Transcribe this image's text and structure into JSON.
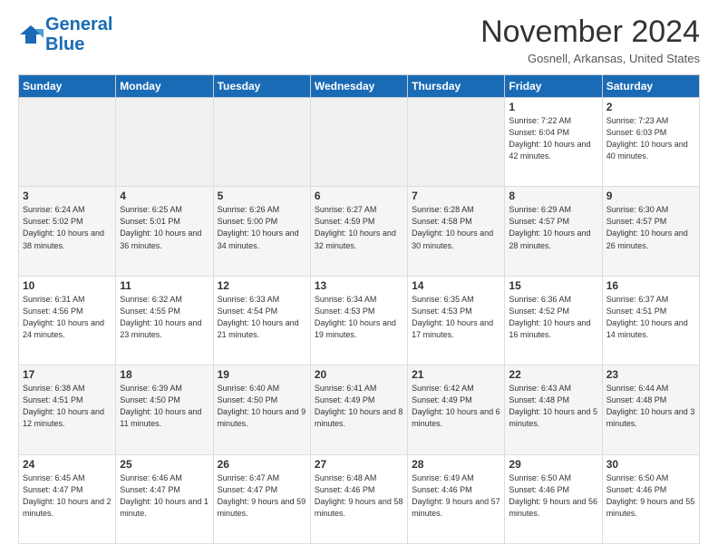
{
  "header": {
    "logo_line1": "General",
    "logo_line2": "Blue",
    "month_title": "November 2024",
    "location": "Gosnell, Arkansas, United States"
  },
  "weekdays": [
    "Sunday",
    "Monday",
    "Tuesday",
    "Wednesday",
    "Thursday",
    "Friday",
    "Saturday"
  ],
  "weeks": [
    [
      {
        "day": "",
        "info": ""
      },
      {
        "day": "",
        "info": ""
      },
      {
        "day": "",
        "info": ""
      },
      {
        "day": "",
        "info": ""
      },
      {
        "day": "",
        "info": ""
      },
      {
        "day": "1",
        "info": "Sunrise: 7:22 AM\nSunset: 6:04 PM\nDaylight: 10 hours\nand 42 minutes."
      },
      {
        "day": "2",
        "info": "Sunrise: 7:23 AM\nSunset: 6:03 PM\nDaylight: 10 hours\nand 40 minutes."
      }
    ],
    [
      {
        "day": "3",
        "info": "Sunrise: 6:24 AM\nSunset: 5:02 PM\nDaylight: 10 hours\nand 38 minutes."
      },
      {
        "day": "4",
        "info": "Sunrise: 6:25 AM\nSunset: 5:01 PM\nDaylight: 10 hours\nand 36 minutes."
      },
      {
        "day": "5",
        "info": "Sunrise: 6:26 AM\nSunset: 5:00 PM\nDaylight: 10 hours\nand 34 minutes."
      },
      {
        "day": "6",
        "info": "Sunrise: 6:27 AM\nSunset: 4:59 PM\nDaylight: 10 hours\nand 32 minutes."
      },
      {
        "day": "7",
        "info": "Sunrise: 6:28 AM\nSunset: 4:58 PM\nDaylight: 10 hours\nand 30 minutes."
      },
      {
        "day": "8",
        "info": "Sunrise: 6:29 AM\nSunset: 4:57 PM\nDaylight: 10 hours\nand 28 minutes."
      },
      {
        "day": "9",
        "info": "Sunrise: 6:30 AM\nSunset: 4:57 PM\nDaylight: 10 hours\nand 26 minutes."
      }
    ],
    [
      {
        "day": "10",
        "info": "Sunrise: 6:31 AM\nSunset: 4:56 PM\nDaylight: 10 hours\nand 24 minutes."
      },
      {
        "day": "11",
        "info": "Sunrise: 6:32 AM\nSunset: 4:55 PM\nDaylight: 10 hours\nand 23 minutes."
      },
      {
        "day": "12",
        "info": "Sunrise: 6:33 AM\nSunset: 4:54 PM\nDaylight: 10 hours\nand 21 minutes."
      },
      {
        "day": "13",
        "info": "Sunrise: 6:34 AM\nSunset: 4:53 PM\nDaylight: 10 hours\nand 19 minutes."
      },
      {
        "day": "14",
        "info": "Sunrise: 6:35 AM\nSunset: 4:53 PM\nDaylight: 10 hours\nand 17 minutes."
      },
      {
        "day": "15",
        "info": "Sunrise: 6:36 AM\nSunset: 4:52 PM\nDaylight: 10 hours\nand 16 minutes."
      },
      {
        "day": "16",
        "info": "Sunrise: 6:37 AM\nSunset: 4:51 PM\nDaylight: 10 hours\nand 14 minutes."
      }
    ],
    [
      {
        "day": "17",
        "info": "Sunrise: 6:38 AM\nSunset: 4:51 PM\nDaylight: 10 hours\nand 12 minutes."
      },
      {
        "day": "18",
        "info": "Sunrise: 6:39 AM\nSunset: 4:50 PM\nDaylight: 10 hours\nand 11 minutes."
      },
      {
        "day": "19",
        "info": "Sunrise: 6:40 AM\nSunset: 4:50 PM\nDaylight: 10 hours\nand 9 minutes."
      },
      {
        "day": "20",
        "info": "Sunrise: 6:41 AM\nSunset: 4:49 PM\nDaylight: 10 hours\nand 8 minutes."
      },
      {
        "day": "21",
        "info": "Sunrise: 6:42 AM\nSunset: 4:49 PM\nDaylight: 10 hours\nand 6 minutes."
      },
      {
        "day": "22",
        "info": "Sunrise: 6:43 AM\nSunset: 4:48 PM\nDaylight: 10 hours\nand 5 minutes."
      },
      {
        "day": "23",
        "info": "Sunrise: 6:44 AM\nSunset: 4:48 PM\nDaylight: 10 hours\nand 3 minutes."
      }
    ],
    [
      {
        "day": "24",
        "info": "Sunrise: 6:45 AM\nSunset: 4:47 PM\nDaylight: 10 hours\nand 2 minutes."
      },
      {
        "day": "25",
        "info": "Sunrise: 6:46 AM\nSunset: 4:47 PM\nDaylight: 10 hours\nand 1 minute."
      },
      {
        "day": "26",
        "info": "Sunrise: 6:47 AM\nSunset: 4:47 PM\nDaylight: 9 hours\nand 59 minutes."
      },
      {
        "day": "27",
        "info": "Sunrise: 6:48 AM\nSunset: 4:46 PM\nDaylight: 9 hours\nand 58 minutes."
      },
      {
        "day": "28",
        "info": "Sunrise: 6:49 AM\nSunset: 4:46 PM\nDaylight: 9 hours\nand 57 minutes."
      },
      {
        "day": "29",
        "info": "Sunrise: 6:50 AM\nSunset: 4:46 PM\nDaylight: 9 hours\nand 56 minutes."
      },
      {
        "day": "30",
        "info": "Sunrise: 6:50 AM\nSunset: 4:46 PM\nDaylight: 9 hours\nand 55 minutes."
      }
    ]
  ]
}
